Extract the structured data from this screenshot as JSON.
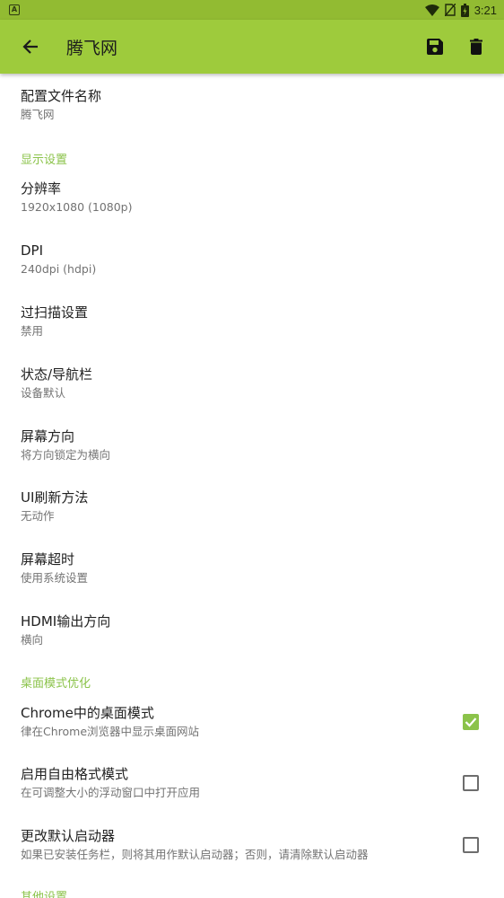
{
  "status_bar": {
    "time": "3:21",
    "notification_icon": "A",
    "icons": [
      "wifi-icon",
      "no-sim-icon",
      "battery-icon"
    ]
  },
  "app_bar": {
    "title": "腾飞网",
    "back_icon": "arrow-back-icon",
    "save_icon": "save-icon",
    "delete_icon": "delete-icon"
  },
  "profile": {
    "title": "配置文件名称",
    "value": "腾飞网"
  },
  "display_settings": {
    "header": "显示设置",
    "items": [
      {
        "title": "分辨率",
        "summary": "1920x1080 (1080p)"
      },
      {
        "title": "DPI",
        "summary": "240dpi (hdpi)"
      },
      {
        "title": "过扫描设置",
        "summary": "禁用"
      },
      {
        "title": "状态/导航栏",
        "summary": "设备默认"
      },
      {
        "title": "屏幕方向",
        "summary": "将方向锁定为横向"
      },
      {
        "title": "UI刷新方法",
        "summary": "无动作"
      },
      {
        "title": "屏幕超时",
        "summary": "使用系统设置"
      },
      {
        "title": "HDMI输出方向",
        "summary": "横向"
      }
    ]
  },
  "desktop_mode": {
    "header": "桌面模式优化",
    "items": [
      {
        "title": "Chrome中的桌面模式",
        "summary": "律在Chrome浏览器中显示桌面网站",
        "checked": true
      },
      {
        "title": "启用自由格式模式",
        "summary": "在可调整大小的浮动窗口中打开应用",
        "checked": false
      },
      {
        "title": "更改默认启动器",
        "summary": "如果已安装任务栏，则将其用作默认启动器；否则，请清除默认启动器",
        "checked": false
      }
    ]
  },
  "other_settings": {
    "header": "其他设置"
  },
  "colors": {
    "status_bar": "#92bb32",
    "app_bar": "#9ecb3c",
    "accent": "#8bc34a"
  }
}
